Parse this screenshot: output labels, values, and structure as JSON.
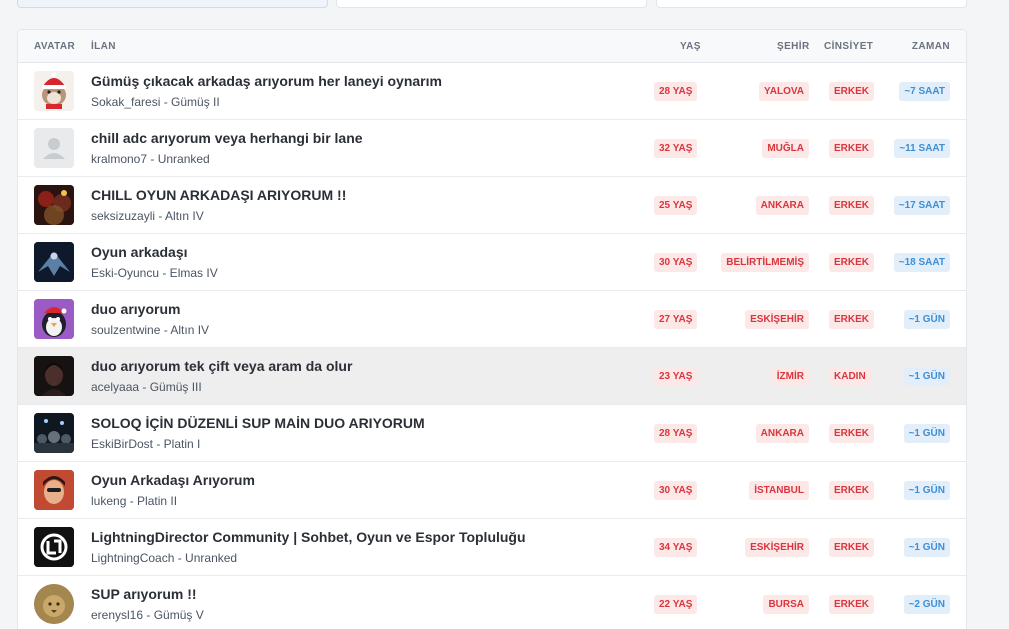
{
  "header": {
    "avatar": "AVATAR",
    "ilan": "İLAN",
    "yas": "YAŞ",
    "sehir": "ŞEHİR",
    "cinsiyet": "CİNSİYET",
    "zaman": "ZAMAN"
  },
  "colors": {
    "badge_red_bg": "#fde8e8",
    "badge_red_text": "#d9363e",
    "badge_blue_bg": "#e2eefa",
    "badge_blue_text": "#3d8fd6",
    "hover_row": "#eeeeee"
  },
  "rows": [
    {
      "title": "Gümüş çıkacak arkadaş arıyorum her laneyi oynarım",
      "sub": "Sokak_faresi - Gümüş II",
      "age": "28 YAŞ",
      "city": "YALOVA",
      "gender": "ERKEK",
      "time": "~7 SAAT",
      "avatar_icon": "hamster-santa-icon"
    },
    {
      "title": "chill adc arıyorum veya herhangi bir lane",
      "sub": "kralmono7 - Unranked",
      "age": "32 YAŞ",
      "city": "MUĞLA",
      "gender": "ERKEK",
      "time": "~11 SAAT",
      "avatar_icon": "default-user-icon"
    },
    {
      "title": "CHILL OYUN ARKADAŞI ARIYORUM !!",
      "sub": "seksizuzayli - Altın IV",
      "age": "25 YAŞ",
      "city": "ANKARA",
      "gender": "ERKEK",
      "time": "~17 SAAT",
      "avatar_icon": "photo-avatar-icon"
    },
    {
      "title": "Oyun arkadaşı",
      "sub": "Eski-Oyuncu - Elmas IV",
      "age": "30 YAŞ",
      "city": "BELİRTİLMEMİŞ",
      "gender": "ERKEK",
      "time": "~18 SAAT",
      "avatar_icon": "dark-wings-icon"
    },
    {
      "title": "duo arıyorum",
      "sub": "soulzentwine - Altın IV",
      "age": "27 YAŞ",
      "city": "ESKİŞEHİR",
      "gender": "ERKEK",
      "time": "~1 GÜN",
      "avatar_icon": "penguin-icon"
    },
    {
      "title": "duo arıyorum tek çift veya aram da olur",
      "sub": "acelyaaa - Gümüş III",
      "age": "23 YAŞ",
      "city": "İZMİR",
      "gender": "KADIN",
      "time": "~1 GÜN",
      "avatar_icon": "dark-portrait-icon"
    },
    {
      "title": "SOLOQ İÇİN DÜZENLİ SUP MAİN DUO ARIYORUM",
      "sub": "EskiBirDost - Platin I",
      "age": "28 YAŞ",
      "city": "ANKARA",
      "gender": "ERKEK",
      "time": "~1 GÜN",
      "avatar_icon": "crowd-icon"
    },
    {
      "title": "Oyun Arkadaşı Arıyorum",
      "sub": "lukeng - Platin II",
      "age": "30 YAŞ",
      "city": "İSTANBUL",
      "gender": "ERKEK",
      "time": "~1 GÜN",
      "avatar_icon": "selfie-icon"
    },
    {
      "title": "LightningDirector Community | Sohbet, Oyun ve Espor Topluluğu",
      "sub": "LightningCoach - Unranked",
      "age": "34 YAŞ",
      "city": "ESKİŞEHİR",
      "gender": "ERKEK",
      "time": "~1 GÜN",
      "avatar_icon": "lightning-logo-icon"
    },
    {
      "title": "SUP arıyorum !!",
      "sub": "erenysl16 - Gümüş V",
      "age": "22 YAŞ",
      "city": "BURSA",
      "gender": "ERKEK",
      "time": "~2 GÜN",
      "avatar_icon": "lion-icon"
    }
  ]
}
